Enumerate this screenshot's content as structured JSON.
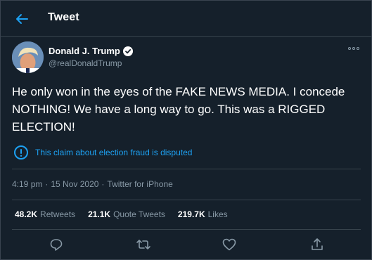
{
  "header": {
    "back_icon": "arrow-left-icon",
    "title": "Tweet"
  },
  "author": {
    "display_name": "Donald J. Trump",
    "handle": "@realDonaldTrump",
    "verified_icon": "verified-badge-icon"
  },
  "tweet": {
    "text": "He only won in the eyes of the FAKE NEWS MEDIA. I concede NOTHING! We have a long way to go. This was a RIGGED ELECTION!",
    "notice": "This claim about election fraud is disputed",
    "time": "4:19 pm",
    "separator": "·",
    "date": "15 Nov 2020",
    "source": "Twitter for iPhone"
  },
  "stats": [
    {
      "value": "48.2K",
      "label": "Retweets"
    },
    {
      "value": "21.1K",
      "label": "Quote Tweets"
    },
    {
      "value": "219.7K",
      "label": "Likes"
    }
  ],
  "actions": [
    "reply-icon",
    "retweet-icon",
    "like-icon",
    "share-icon"
  ],
  "colors": {
    "background": "#15202b",
    "accent": "#1da1f2",
    "secondary_text": "#8899a6",
    "divider": "#38444d"
  }
}
